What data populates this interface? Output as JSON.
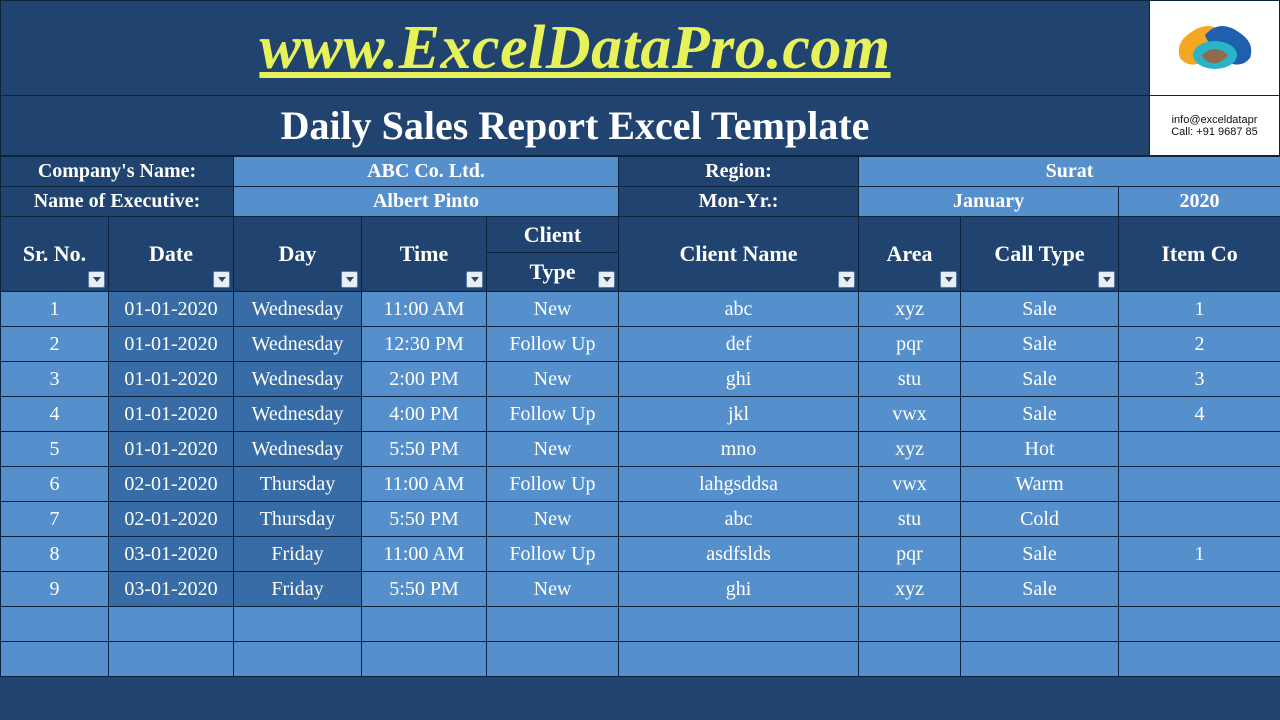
{
  "header": {
    "url": "www.ExcelDataPro.com",
    "title": "Daily Sales Report Excel Template",
    "contact_email": "info@exceldatapr",
    "contact_phone": "Call: +91 9687 85"
  },
  "info": {
    "company_label": "Company's Name:",
    "company_value": "ABC Co. Ltd.",
    "region_label": "Region:",
    "region_value": "Surat",
    "executive_label": "Name of Executive:",
    "executive_value": "Albert Pinto",
    "monyr_label": "Mon-Yr.:",
    "month_value": "January",
    "year_value": "2020"
  },
  "columns": {
    "sr": "Sr. No.",
    "date": "Date",
    "day": "Day",
    "time": "Time",
    "client_type": "Client Type",
    "client_name": "Client Name",
    "area": "Area",
    "call_type": "Call Type",
    "item_co": "Item Co"
  },
  "rows": [
    {
      "sr": "1",
      "date": "01-01-2020",
      "day": "Wednesday",
      "time": "11:00 AM",
      "type": "New",
      "name": "abc",
      "area": "xyz",
      "call": "Sale",
      "item": "1"
    },
    {
      "sr": "2",
      "date": "01-01-2020",
      "day": "Wednesday",
      "time": "12:30 PM",
      "type": "Follow Up",
      "name": "def",
      "area": "pqr",
      "call": "Sale",
      "item": "2"
    },
    {
      "sr": "3",
      "date": "01-01-2020",
      "day": "Wednesday",
      "time": "2:00 PM",
      "type": "New",
      "name": "ghi",
      "area": "stu",
      "call": "Sale",
      "item": "3"
    },
    {
      "sr": "4",
      "date": "01-01-2020",
      "day": "Wednesday",
      "time": "4:00 PM",
      "type": "Follow Up",
      "name": "jkl",
      "area": "vwx",
      "call": "Sale",
      "item": "4"
    },
    {
      "sr": "5",
      "date": "01-01-2020",
      "day": "Wednesday",
      "time": "5:50 PM",
      "type": "New",
      "name": "mno",
      "area": "xyz",
      "call": "Hot",
      "item": ""
    },
    {
      "sr": "6",
      "date": "02-01-2020",
      "day": "Thursday",
      "time": "11:00 AM",
      "type": "Follow Up",
      "name": "lahgsddsa",
      "area": "vwx",
      "call": "Warm",
      "item": ""
    },
    {
      "sr": "7",
      "date": "02-01-2020",
      "day": "Thursday",
      "time": "5:50 PM",
      "type": "New",
      "name": "abc",
      "area": "stu",
      "call": "Cold",
      "item": ""
    },
    {
      "sr": "8",
      "date": "03-01-2020",
      "day": "Friday",
      "time": "11:00 AM",
      "type": "Follow Up",
      "name": "asdfslds",
      "area": "pqr",
      "call": "Sale",
      "item": "1"
    },
    {
      "sr": "9",
      "date": "03-01-2020",
      "day": "Friday",
      "time": "5:50 PM",
      "type": "New",
      "name": "ghi",
      "area": "xyz",
      "call": "Sale",
      "item": ""
    }
  ]
}
